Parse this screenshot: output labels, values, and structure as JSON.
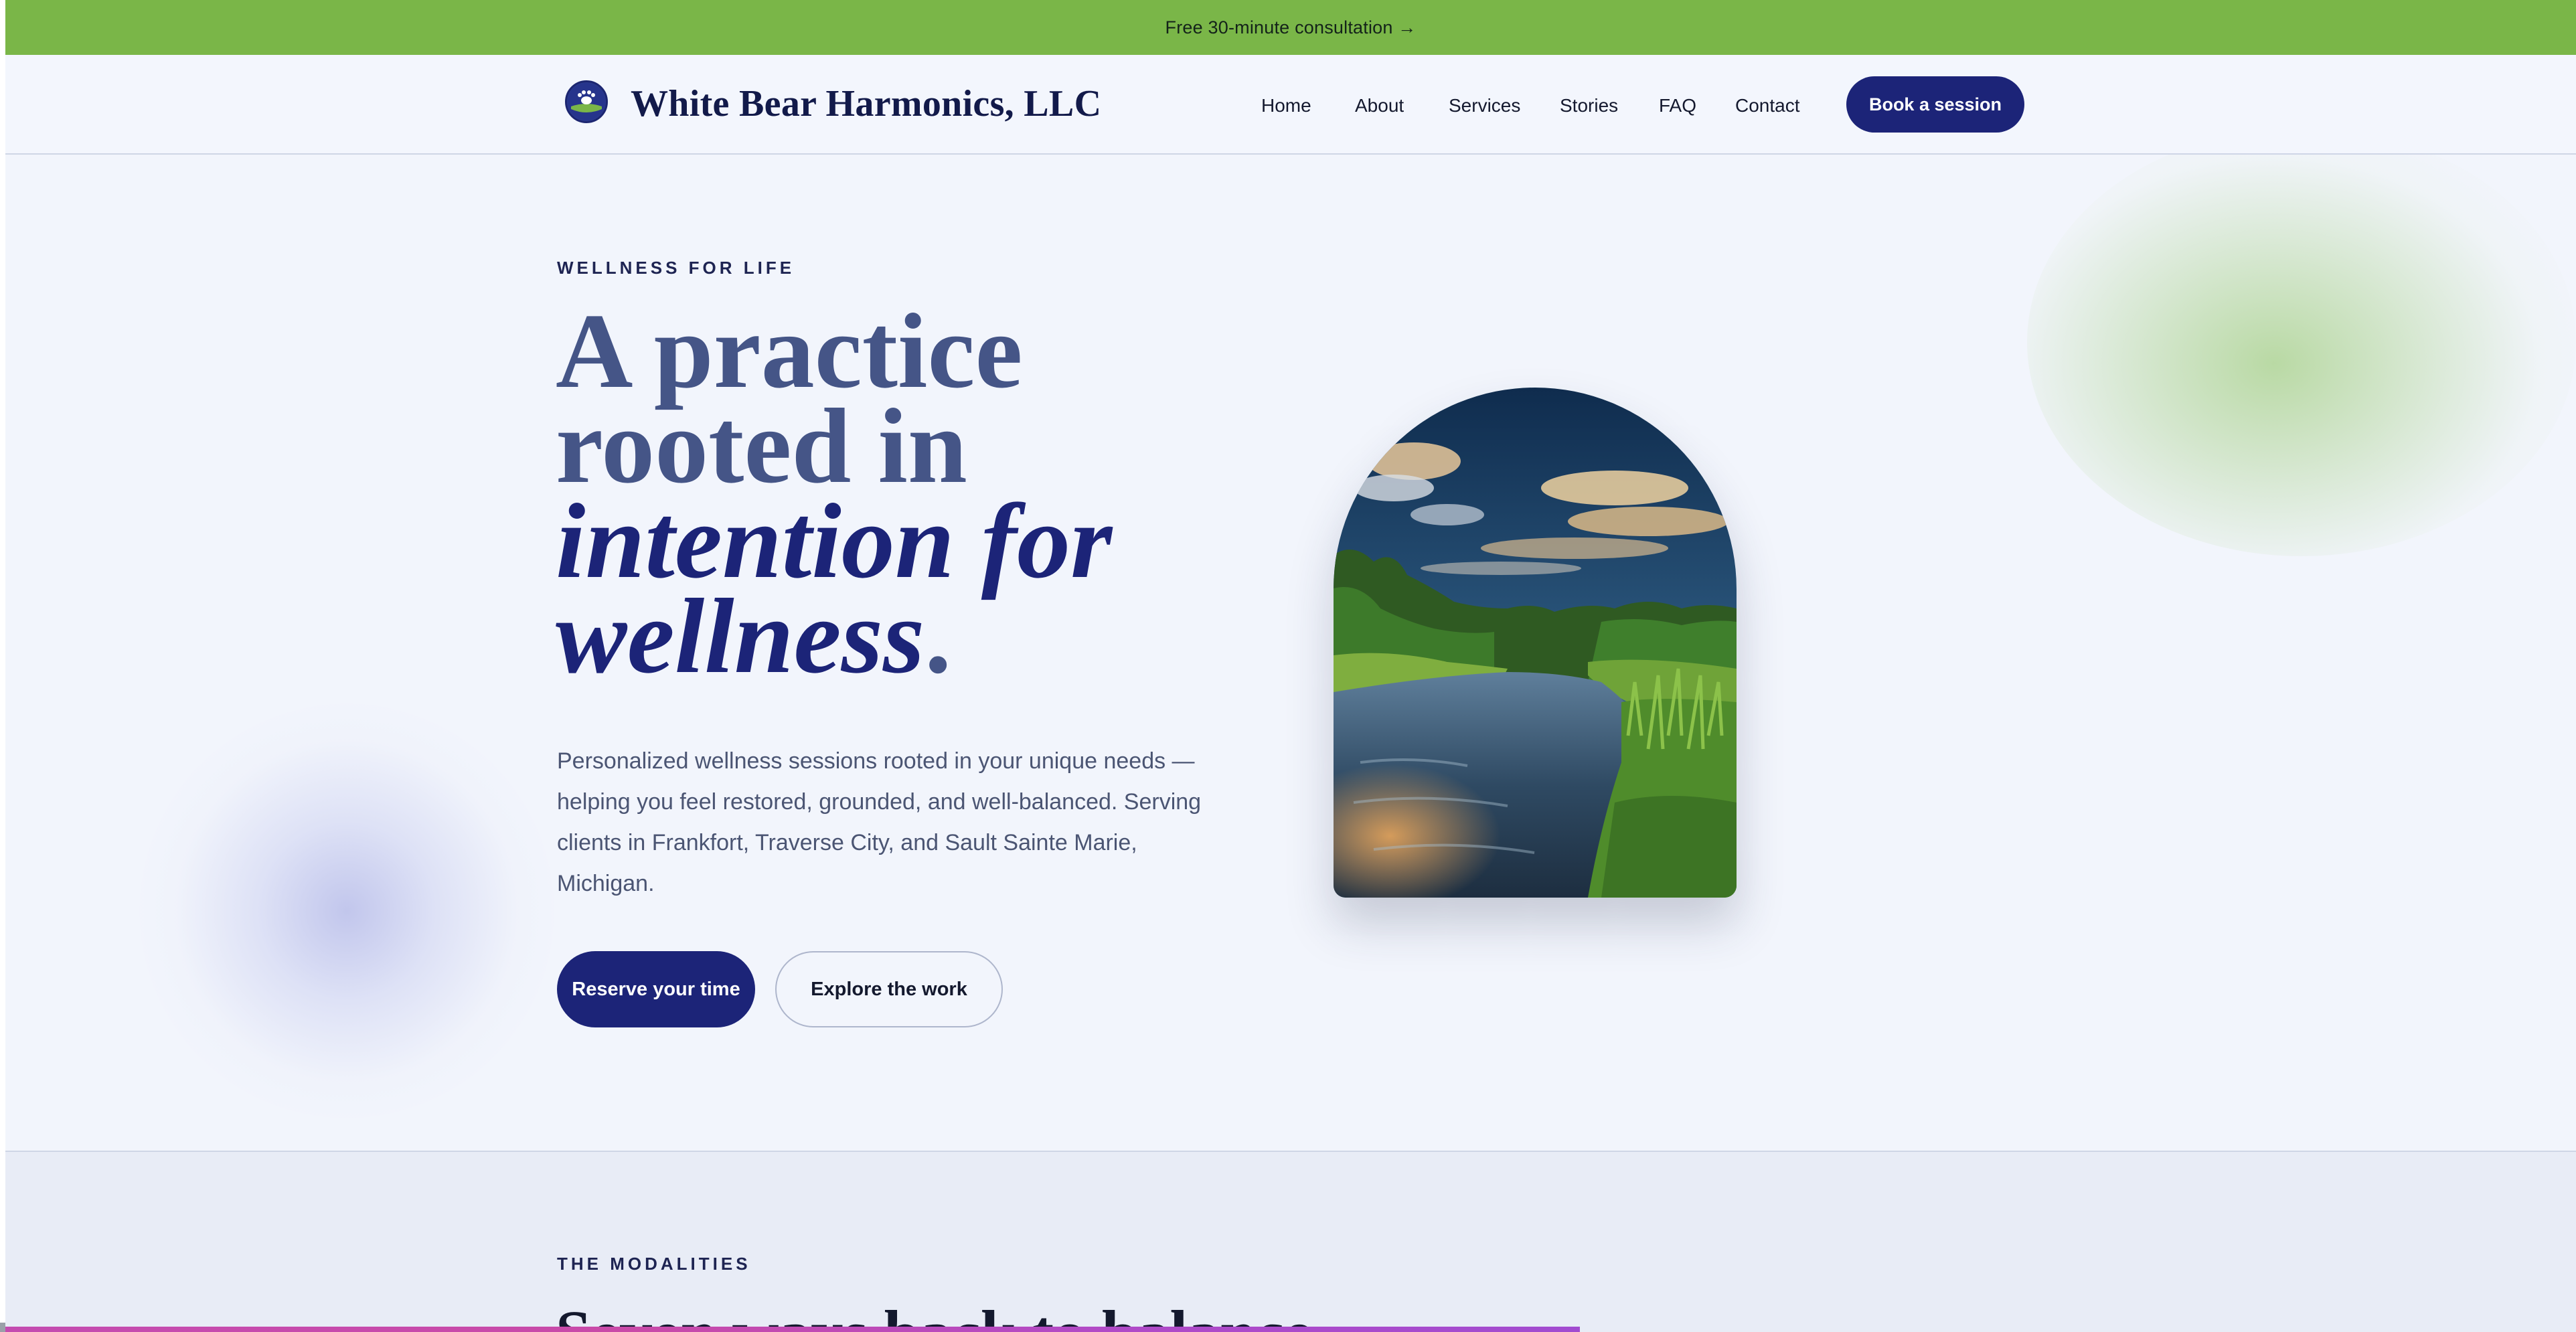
{
  "announcement": {
    "text": "Free 30-minute consultation →"
  },
  "brand": {
    "name": "White Bear Harmonics, LLC",
    "logo_icon": "bear-paw-icon"
  },
  "nav": {
    "items": [
      {
        "label": "Home"
      },
      {
        "label": "About"
      },
      {
        "label": "Services"
      },
      {
        "label": "Stories"
      },
      {
        "label": "FAQ"
      },
      {
        "label": "Contact"
      }
    ],
    "cta_label": "Book a session"
  },
  "hero": {
    "eyebrow": "WELLNESS FOR LIFE",
    "headline_line1": "A practice",
    "headline_line2": "rooted in",
    "headline_line3": "intention for",
    "headline_line4": "wellness",
    "headline_period": ".",
    "lede": "Personalized wellness sessions rooted in your unique needs — helping you feel restored, grounded, and well-balanced. Serving clients in Frankfort, Traverse City, and Sault Sainte Marie, Michigan.",
    "primary_cta": "Reserve your time",
    "secondary_cta": "Explore the work"
  },
  "modalities": {
    "eyebrow": "THE MODALITIES",
    "title": "Seven ways back to balance"
  },
  "colors": {
    "announcement_bg": "#7ab648",
    "brand_navy": "#1c2478",
    "headline_slate": "#455587",
    "page_bg": "#f2f5fc"
  }
}
